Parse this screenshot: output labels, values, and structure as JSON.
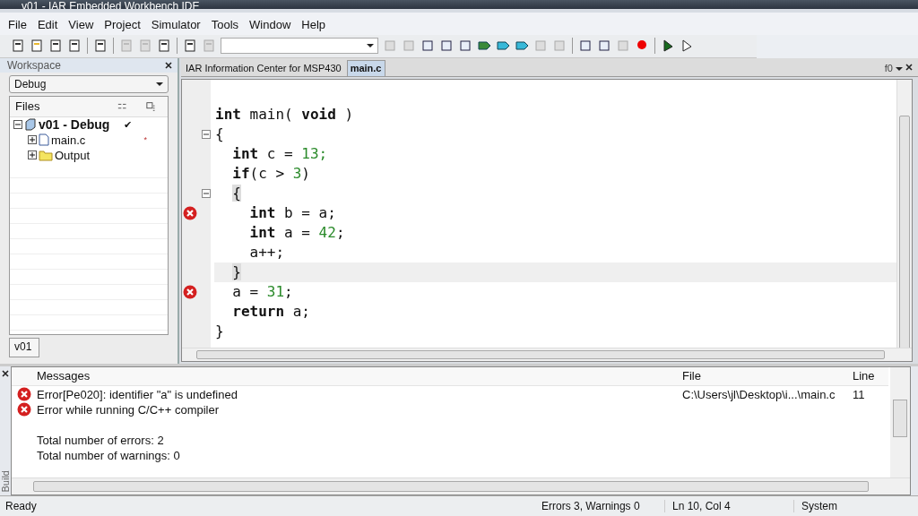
{
  "window": {
    "title": "v01 - IAR Embedded Workbench IDE"
  },
  "menu": [
    "File",
    "Edit",
    "View",
    "Project",
    "Simulator",
    "Tools",
    "Window",
    "Help"
  ],
  "workspace": {
    "title": "Workspace",
    "config": "Debug",
    "files_header": "Files",
    "tab": "v01",
    "tree": [
      {
        "label": "v01 - Debug",
        "kind": "project",
        "expanded": true,
        "mark": "✔",
        "children": [
          {
            "label": "main.c",
            "kind": "file",
            "expanded": false,
            "mark": "*"
          },
          {
            "label": "Output",
            "kind": "folder",
            "expanded": false
          }
        ]
      }
    ]
  },
  "editor": {
    "tabs": [
      {
        "label": "IAR Information Center for MSP430",
        "selected": false
      },
      {
        "label": "main.c",
        "selected": true
      }
    ],
    "function_box": "f0",
    "lines": [
      {
        "tokens": [
          {
            "text": "int",
            "kind": "kw"
          },
          {
            "text": " main( ",
            "kind": "plain"
          },
          {
            "text": "void",
            "kind": "kw"
          },
          {
            "text": " )",
            "kind": "plain"
          }
        ]
      },
      {
        "foldable": true,
        "tokens": [
          {
            "text": "{",
            "kind": "plain"
          }
        ]
      },
      {
        "tokens": [
          {
            "text": "  int",
            "kind": "kw"
          },
          {
            "text": " c = ",
            "kind": "plain"
          },
          {
            "text": "13;",
            "kind": "num"
          }
        ]
      },
      {
        "tokens": [
          {
            "text": "  if",
            "kind": "kw"
          },
          {
            "text": "(c > ",
            "kind": "plain"
          },
          {
            "text": "3",
            "kind": "num"
          },
          {
            "text": ")",
            "kind": "plain"
          }
        ]
      },
      {
        "foldable": true,
        "tokens": [
          {
            "text": "  {",
            "kind": "match"
          }
        ]
      },
      {
        "error": true,
        "tokens": [
          {
            "text": "    int",
            "kind": "kw"
          },
          {
            "text": " b = a;",
            "kind": "plain"
          }
        ]
      },
      {
        "tokens": [
          {
            "text": "    int",
            "kind": "kw"
          },
          {
            "text": " a = ",
            "kind": "plain"
          },
          {
            "text": "42",
            "kind": "num"
          },
          {
            "text": ";",
            "kind": "plain"
          }
        ]
      },
      {
        "tokens": [
          {
            "text": "    a++;",
            "kind": "plain"
          }
        ]
      },
      {
        "current": true,
        "tokens": [
          {
            "text": "  }",
            "kind": "match"
          }
        ]
      },
      {
        "error": true,
        "tokens": [
          {
            "text": "  a = ",
            "kind": "plain"
          },
          {
            "text": "31",
            "kind": "num"
          },
          {
            "text": ";",
            "kind": "plain"
          }
        ]
      },
      {
        "tokens": [
          {
            "text": "  return",
            "kind": "kw"
          },
          {
            "text": " a;",
            "kind": "plain"
          }
        ]
      },
      {
        "tokens": [
          {
            "text": "}",
            "kind": "plain"
          }
        ]
      }
    ]
  },
  "build": {
    "side_label": "Build",
    "columns": [
      "Messages",
      "File",
      "Line"
    ],
    "rows": [
      {
        "kind": "error",
        "message": "Error[Pe020]: identifier \"a\" is undefined",
        "file": "C:\\Users\\jl\\Desktop\\i...\\main.c",
        "line": "11"
      },
      {
        "kind": "error",
        "message": "Error while running C/C++ compiler"
      },
      {
        "kind": "blank"
      },
      {
        "kind": "text",
        "message": "Total number of errors: 2"
      },
      {
        "kind": "text",
        "message": "Total number of warnings: 0"
      }
    ]
  },
  "status_bar": {
    "state": "Ready",
    "counts": "Errors 3, Warnings 0",
    "position": "Ln 10, Col 4",
    "encoding": "System"
  }
}
